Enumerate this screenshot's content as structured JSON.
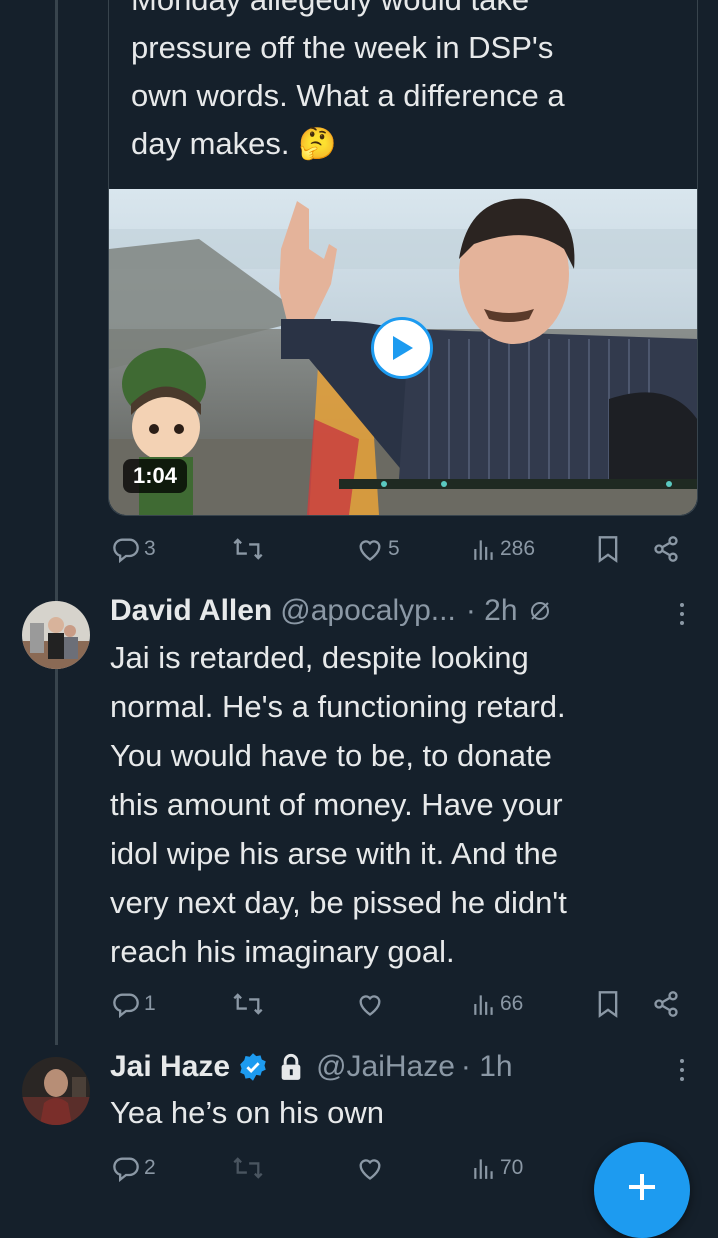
{
  "quoted_post": {
    "text_lines": [
      "Monday allegedly would take",
      "pressure off the week in DSP's",
      "own words. What a difference a",
      "day makes. 🤔"
    ],
    "video": {
      "duration": "1:04"
    },
    "actions": {
      "replies": "3",
      "reposts": "",
      "likes": "5",
      "views": "286"
    }
  },
  "replies": [
    {
      "name": "David Allen",
      "handle": "@apocalyp...",
      "time": "· 2h",
      "text_lines": [
        "Jai is retarded, despite looking",
        "normal. He's a functioning retard.",
        "You would have to be, to donate",
        "this amount of money. Have your",
        "idol wipe his arse with it. And the",
        "very next day, be pissed he didn't",
        "reach his imaginary goal."
      ],
      "actions": {
        "replies": "1",
        "reposts": "",
        "likes": "",
        "views": "66"
      }
    },
    {
      "name": "Jai Haze",
      "handle": "@JaiHaze",
      "time": "· 1h",
      "verified": true,
      "protected": true,
      "text_lines": [
        "Yea he’s on his own"
      ],
      "actions": {
        "replies": "2",
        "reposts": "",
        "likes": "",
        "views": "70"
      }
    }
  ],
  "fab": {
    "icon": "plus-icon"
  },
  "colors": {
    "background": "#15202b",
    "accent": "#1d9bf0",
    "muted": "#8b98a5",
    "text": "#e7e9ea"
  }
}
